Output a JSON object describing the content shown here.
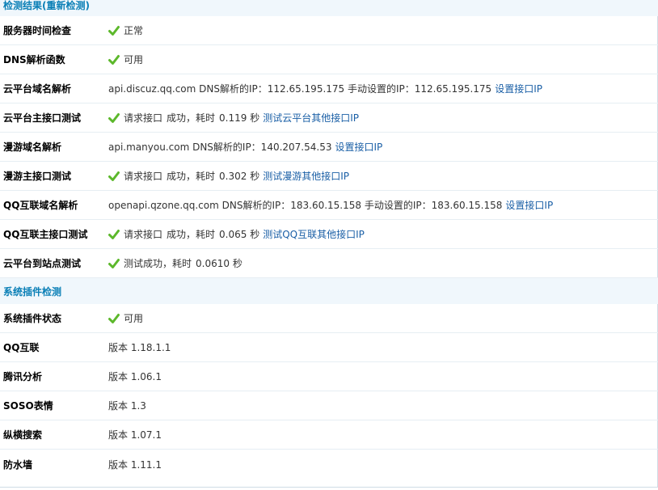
{
  "sections": {
    "check_results_title": "检测结果(重新检测)",
    "plugin_check_title": "系统插件检测"
  },
  "rows": {
    "server_time": {
      "label": "服务器时间检查",
      "status": "正常"
    },
    "dns_func": {
      "label": "DNS解析函数",
      "status": "可用"
    },
    "cloud_domain": {
      "label": "云平台域名解析",
      "text": "api.discuz.qq.com DNS解析的IP：112.65.195.175 手动设置的IP：112.65.195.175",
      "link": "设置接口IP"
    },
    "cloud_main_api": {
      "label": "云平台主接口测试",
      "text1": "请求接口",
      "text2": "成功，耗时",
      "time": "0.119 秒",
      "link": "测试云平台其他接口IP"
    },
    "manyou_domain": {
      "label": "漫游域名解析",
      "text": "api.manyou.com DNS解析的IP：140.207.54.53",
      "link": "设置接口IP"
    },
    "manyou_main_api": {
      "label": "漫游主接口测试",
      "text1": "请求接口",
      "text2": "成功，耗时",
      "time": "0.302 秒",
      "link": "测试漫游其他接口IP"
    },
    "qq_domain": {
      "label": "QQ互联域名解析",
      "text": "openapi.qzone.qq.com DNS解析的IP：183.60.15.158 手动设置的IP：183.60.15.158",
      "link": "设置接口IP"
    },
    "qq_main_api": {
      "label": "QQ互联主接口测试",
      "text1": "请求接口",
      "text2": "成功，耗时",
      "time": "0.065 秒",
      "link": "测试QQ互联其他接口IP"
    },
    "cloud_to_site": {
      "label": "云平台到站点测试",
      "text1": "测试成功，耗时",
      "time": "0.0610 秒"
    },
    "plugin_status": {
      "label": "系统插件状态",
      "status": "可用"
    },
    "qq_connect": {
      "label": "QQ互联",
      "version": "版本  1.18.1.1"
    },
    "tencent_analysis": {
      "label": "腾讯分析",
      "version": "版本  1.06.1"
    },
    "soso_emoji": {
      "label": "SOSO表情",
      "version": "版本  1.3"
    },
    "zongheng_search": {
      "label": "纵横搜索",
      "version": "版本  1.07.1"
    },
    "firewall": {
      "label": "防水墙",
      "version": "版本  1.11.1"
    }
  },
  "colors": {
    "header_bg": "#f0f7fc",
    "header_text": "#0a7fb6",
    "link": "#1a5fa6",
    "check": "#5cb82b"
  }
}
